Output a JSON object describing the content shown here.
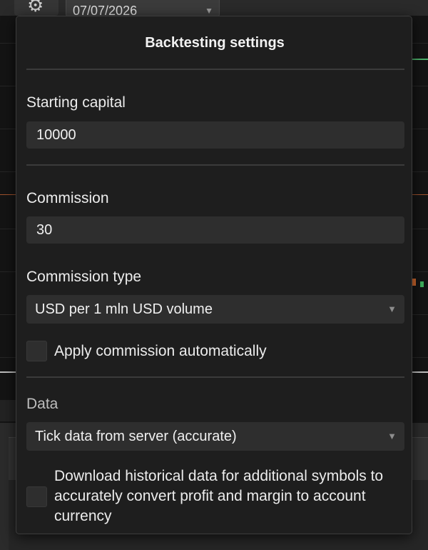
{
  "background": {
    "toolbar": {
      "settings_icon": "gear-icon",
      "date_value": "07/07/2026"
    }
  },
  "popup": {
    "title": "Backtesting settings",
    "starting_capital": {
      "label": "Starting capital",
      "value": "10000"
    },
    "commission": {
      "label": "Commission",
      "value": "30"
    },
    "commission_type": {
      "label": "Commission type",
      "selected": "USD per 1 mln USD volume"
    },
    "apply_commission": {
      "label": "Apply commission automatically",
      "checked": false
    },
    "data": {
      "label": "Data",
      "selected": "Tick data from server (accurate)"
    },
    "download_history": {
      "label": "Download historical data for additional symbols to accurately convert profit and margin to account currency",
      "checked": false
    }
  },
  "colors": {
    "popup_bg": "#1e1e1e",
    "field_bg": "#2e2e2e",
    "text": "#ececec",
    "chart_green": "#4caf6a",
    "chart_orange": "#d2692d"
  }
}
